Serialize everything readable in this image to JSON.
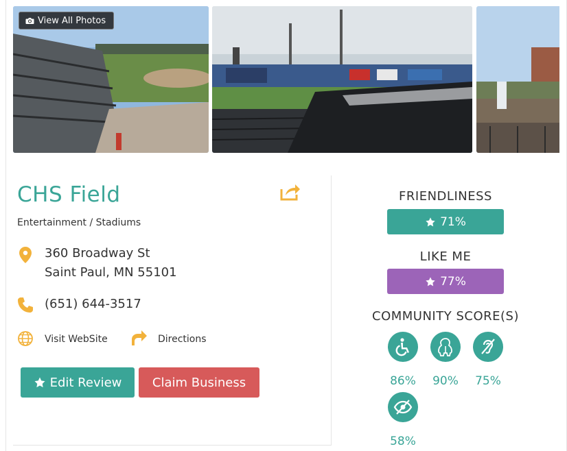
{
  "gallery": {
    "view_all_label": "View All Photos"
  },
  "business": {
    "name": "CHS Field",
    "categories": "Entertainment / Stadiums",
    "address_line1": "360 Broadway St",
    "address_line2": "Saint Paul, MN 55101",
    "phone": "(651) 644-3517",
    "website_label": "Visit WebSite",
    "directions_label": "Directions"
  },
  "actions": {
    "edit_review_label": "Edit Review",
    "claim_business_label": "Claim Business"
  },
  "ratings": {
    "friendliness_heading": "FRIENDLINESS",
    "friendliness_value": "71%",
    "like_me_heading": "LIKE ME",
    "like_me_value": "77%",
    "community_heading": "COMMUNITY SCORE(S)",
    "community_scores": [
      {
        "icon": "wheelchair-icon",
        "value": "86%"
      },
      {
        "icon": "person-icon",
        "value": "90%"
      },
      {
        "icon": "hearing-impaired-icon",
        "value": "75%"
      },
      {
        "icon": "vision-impaired-icon",
        "value": "58%"
      }
    ]
  },
  "colors": {
    "teal": "#3aa597",
    "purple": "#9c64b8",
    "red": "#d75a5a",
    "gold": "#f2b23b"
  }
}
